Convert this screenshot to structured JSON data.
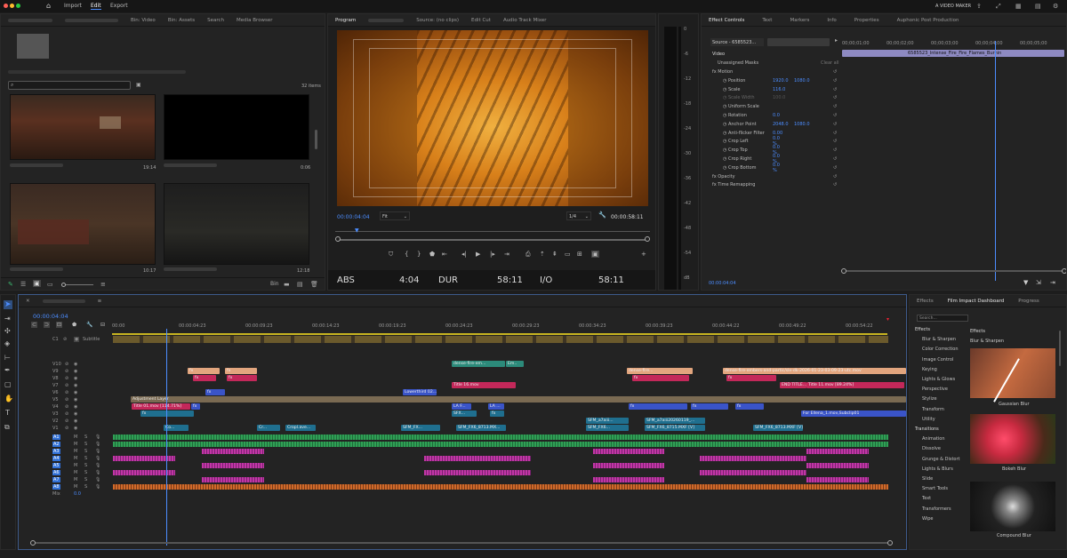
{
  "menubar": {
    "items": [
      "Import",
      "Edit",
      "Export"
    ],
    "active": "Edit",
    "right_label": "A VIDEO MAKER"
  },
  "project": {
    "tabs": [
      "Bin: Video",
      "Bin: Assets",
      "Search",
      "Media Browser"
    ],
    "item_count": "32 items",
    "thumbs": [
      {
        "duration": "19:14"
      },
      {
        "duration": "0:06"
      },
      {
        "duration": "10:17"
      },
      {
        "duration": "12:18"
      }
    ]
  },
  "program": {
    "tabs": [
      "Source: (no clips)",
      "Edit Cut",
      "Audio Track Mixer"
    ],
    "title": "Program",
    "timecode": "00:00:04:04",
    "fit": "Fit",
    "quality": "1/4",
    "duration": "00:00:58:11",
    "status": {
      "abs_label": "ABS",
      "abs_value": "4:04",
      "dur_label": "DUR",
      "dur_value": "58:11",
      "io_label": "I/O",
      "io_value": "58:11"
    }
  },
  "meter": {
    "ticks": [
      "0",
      "-6",
      "-12",
      "-18",
      "-24",
      "-30",
      "-36",
      "-42",
      "-48",
      "-54",
      "dB"
    ]
  },
  "effect_controls": {
    "tabs": [
      "Effect Controls",
      "Text",
      "Markers",
      "Info",
      "Properties",
      "Auphonic Post Production"
    ],
    "source": "Source - 6585523...",
    "ruler": [
      "00;00;01;00",
      "00;00;02;00",
      "00;00;03;00",
      "00;00;04;00",
      "00;00;05;00"
    ],
    "clip_name": "6585523_Intense_Fire_Fire_Flames_Burnin",
    "video_label": "Video",
    "masks_label": "Unassigned Masks",
    "clear_label": "Clear all",
    "props": [
      {
        "name": "Motion",
        "v1": "",
        "v2": ""
      },
      {
        "name": "Position",
        "v1": "1920.0",
        "v2": "1080.0"
      },
      {
        "name": "Scale",
        "v1": "116.0",
        "v2": ""
      },
      {
        "name": "Scale Width",
        "v1": "100.0",
        "v2": ""
      },
      {
        "name": "Uniform Scale",
        "v1": "",
        "v2": ""
      },
      {
        "name": "Rotation",
        "v1": "0.0",
        "v2": ""
      },
      {
        "name": "Anchor Point",
        "v1": "2048.0",
        "v2": "1080.0"
      },
      {
        "name": "Anti-flicker Filter",
        "v1": "0.00",
        "v2": ""
      },
      {
        "name": "Crop Left",
        "v1": "0.0 %",
        "v2": ""
      },
      {
        "name": "Crop Top",
        "v1": "0.0 %",
        "v2": ""
      },
      {
        "name": "Crop Right",
        "v1": "0.0 %",
        "v2": ""
      },
      {
        "name": "Crop Bottom",
        "v1": "0.0 %",
        "v2": ""
      },
      {
        "name": "Opacity",
        "v1": "",
        "v2": ""
      },
      {
        "name": "Time Remapping",
        "v1": "",
        "v2": ""
      }
    ],
    "timecode": "00:00:04:04"
  },
  "timeline": {
    "timecode": "00:00:04:04",
    "ruler": [
      "00:00",
      "00:00:04:23",
      "00:00:09:23",
      "00:00:14:23",
      "00:00:19:23",
      "00:00:24:23",
      "00:00:29:23",
      "00:00:34:23",
      "00:00:39:23",
      "00:00:44:22",
      "00:00:49:22",
      "00:00:54:22"
    ],
    "subtitle_label": "Subtitle",
    "caption_track": "C1",
    "video_tracks": [
      "V10",
      "V9",
      "V8",
      "V7",
      "V6",
      "V5",
      "V4",
      "V3",
      "V2",
      "V1"
    ],
    "audio_tracks": [
      "A1",
      "A2",
      "A3",
      "A4",
      "A5",
      "A6",
      "A7",
      "A8"
    ],
    "mix_label": "Mix",
    "mix_value": "0.0",
    "clips": [
      {
        "label": "dense-fire-em...",
        "color": "#2c8a7a",
        "track": 0,
        "start": 487,
        "width": 60
      },
      {
        "label": "Em..",
        "color": "#2c8a7a",
        "track": 0,
        "start": 548,
        "width": 20
      },
      {
        "label": "fx",
        "color": "#e2a57e",
        "track": 1,
        "start": 190,
        "width": 36
      },
      {
        "label": "fx",
        "color": "#e2a57e",
        "track": 1,
        "start": 232,
        "width": 36
      },
      {
        "label": "dense-fire...",
        "color": "#e2a57e",
        "track": 1,
        "start": 684,
        "width": 74
      },
      {
        "label": "dense-fire-embers-and-partic/sle-dk-2026-01-23-03-09-23-utc.mov",
        "color": "#e2a57e",
        "track": 1,
        "start": 792,
        "width": 206
      },
      {
        "label": "fx",
        "color": "#c3285a",
        "track": 2,
        "start": 196,
        "width": 26
      },
      {
        "label": "fx",
        "color": "#c3285a",
        "track": 2,
        "start": 234,
        "width": 34
      },
      {
        "label": "fx",
        "color": "#c3285a",
        "track": 2,
        "start": 690,
        "width": 64
      },
      {
        "label": "fx",
        "color": "#c3285a",
        "track": 2,
        "start": 796,
        "width": 56
      },
      {
        "label": "Title 16.mov",
        "color": "#c3285a",
        "track": 3,
        "start": 487,
        "width": 72
      },
      {
        "label": "END TITLE...",
        "color": "#c3285a",
        "track": 3,
        "start": 856,
        "width": 30
      },
      {
        "label": "Title 11.mov [89.24%]",
        "color": "#c3285a",
        "track": 3,
        "start": 886,
        "width": 110
      },
      {
        "label": "fx",
        "color": "#3a54c8",
        "track": 4,
        "start": 210,
        "width": 22
      },
      {
        "label": "Lowerthird 02...",
        "color": "#3a54c8",
        "track": 4,
        "start": 432,
        "width": 38
      },
      {
        "label": "Adjustment Layer",
        "color": "#7a6a52",
        "track": 5,
        "start": 126,
        "width": 872
      },
      {
        "label": "Title 01.mov [114.71%]",
        "color": "#c3285a",
        "track": 6,
        "start": 127,
        "width": 66
      },
      {
        "label": "fx",
        "color": "#3a54c8",
        "track": 6,
        "start": 194,
        "width": 10
      },
      {
        "label": "LA F...",
        "color": "#3a54c8",
        "track": 6,
        "start": 487,
        "width": 22
      },
      {
        "label": "LA ...",
        "color": "#3a54c8",
        "track": 6,
        "start": 528,
        "width": 18
      },
      {
        "label": "fx",
        "color": "#3a54c8",
        "track": 6,
        "start": 686,
        "width": 66
      },
      {
        "label": "fx",
        "color": "#3a54c8",
        "track": 6,
        "start": 756,
        "width": 42
      },
      {
        "label": "fx",
        "color": "#3a54c8",
        "track": 6,
        "start": 806,
        "width": 32
      },
      {
        "label": "For Ellena_1.mov,Subclip01",
        "color": "#3a54c8",
        "track": 7,
        "start": 880,
        "width": 118
      },
      {
        "label": "fx",
        "color": "#1f6f8f",
        "track": 7,
        "start": 137,
        "width": 60
      },
      {
        "label": "SFX...",
        "color": "#1f6f8f",
        "track": 7,
        "start": 487,
        "width": 28
      },
      {
        "label": "fx",
        "color": "#1f6f8f",
        "track": 7,
        "start": 530,
        "width": 16
      },
      {
        "label": "SFM_a7aiii...",
        "color": "#1f6f8f",
        "track": 8,
        "start": 638,
        "width": 48
      },
      {
        "label": "SFM_a7aiii20260119_...",
        "color": "#1f6f8f",
        "track": 8,
        "start": 704,
        "width": 68
      },
      {
        "label": "Co...",
        "color": "#1f6f8f",
        "track": 9,
        "start": 163,
        "width": 28
      },
      {
        "label": "Cr...",
        "color": "#1f6f8f",
        "track": 9,
        "start": 268,
        "width": 26
      },
      {
        "label": "Cropl.ave...",
        "color": "#1f6f8f",
        "track": 9,
        "start": 300,
        "width": 34
      },
      {
        "label": "SFM_FX...",
        "color": "#1f6f8f",
        "track": 9,
        "start": 430,
        "width": 44
      },
      {
        "label": "SFM_FX6_8713.MX...",
        "color": "#1f6f8f",
        "track": 9,
        "start": 492,
        "width": 56
      },
      {
        "label": "SFM_FX6...",
        "color": "#1f6f8f",
        "track": 9,
        "start": 638,
        "width": 48
      },
      {
        "label": "SFM_FX6_8715.MXF [V]",
        "color": "#1f6f8f",
        "track": 9,
        "start": 704,
        "width": 68
      },
      {
        "label": "SFM_FX6_8713.MXF [V]",
        "color": "#1f6f8f",
        "track": 9,
        "start": 826,
        "width": 56
      }
    ]
  },
  "effects": {
    "tabs": [
      "Effects",
      "Film Impact Dashboard",
      "Progress"
    ],
    "search_placeholder": "Search...",
    "categories": [
      "Effects",
      "Blur & Sharpen",
      "Color Correction",
      "Image Control",
      "Keying",
      "Lights & Glows",
      "Perspective",
      "Stylize",
      "Transform",
      "Utility",
      "Transitions",
      "Animation",
      "Dissolve",
      "Grunge & Distort",
      "Lights & Blurs",
      "Slide",
      "Smart Tools",
      "Text",
      "Transformers",
      "Wipe"
    ],
    "section": "Effects",
    "subsection": "Blur & Sharpen",
    "presets": [
      "Gaussian Blur",
      "Bokeh Blur",
      "Compound Blur"
    ]
  }
}
